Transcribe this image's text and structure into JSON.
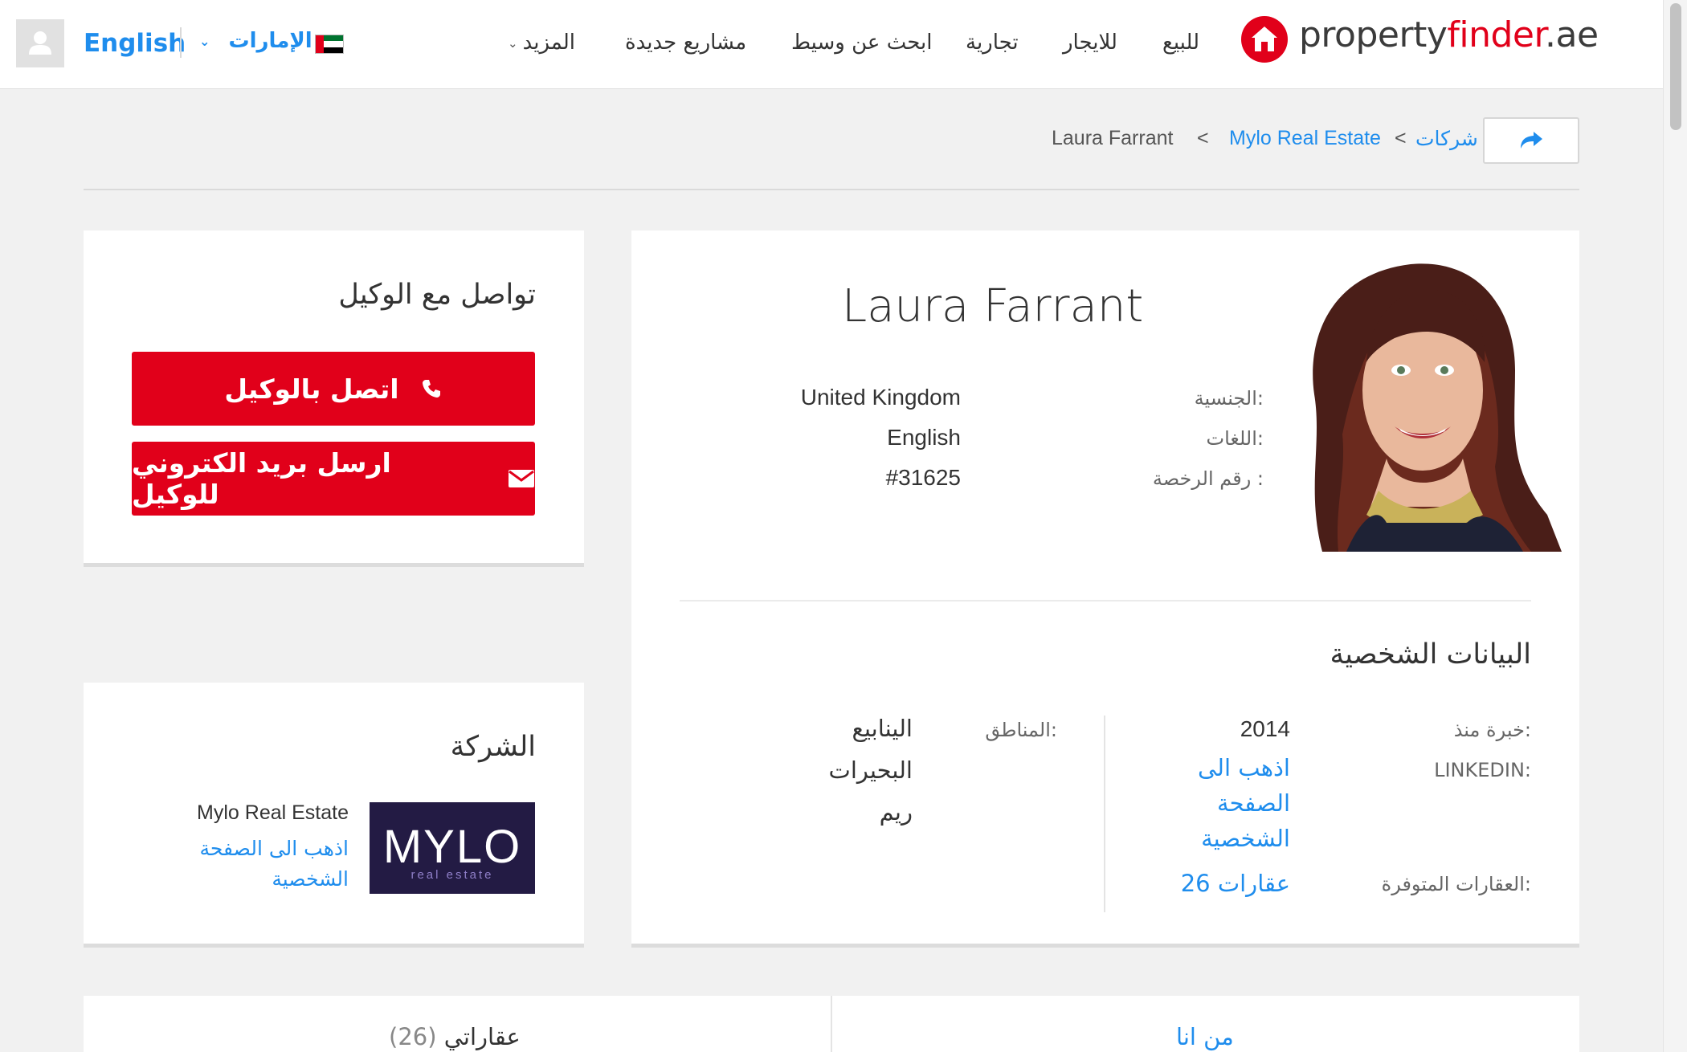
{
  "header": {
    "language_switch": "English",
    "country": "الإمارات",
    "nav": {
      "more": "المزيد",
      "new_projects": "مشاريع جديدة",
      "find_agent": "ابحث عن وسيط",
      "commercial": "تجارية",
      "rent": "للايجار",
      "buy": "للبيع"
    },
    "logo": {
      "part1": "property",
      "part2": "finder",
      "part3": ".ae"
    },
    "colors": {
      "brand_red": "#e1001a",
      "link_blue": "#1f8ded"
    }
  },
  "breadcrumb": {
    "companies": "شركات",
    "separator": "<",
    "company": "Mylo Real Estate",
    "agent": "Laura Farrant"
  },
  "contact": {
    "title": "تواصل مع الوكيل",
    "call_label": "اتصل بالوكيل",
    "email_label": "ارسل بريد الكتروني للوكيل"
  },
  "profile": {
    "name": "Laura Farrant",
    "nationality_label": "الجنسية:",
    "nationality": "United Kingdom",
    "languages_label": "اللغات:",
    "languages": "English",
    "license_label": "رقم الرخصة :",
    "license": "#31625"
  },
  "personal": {
    "title": "البيانات الشخصية",
    "experience_label": "خبرة منذ:",
    "experience": "2014",
    "linkedin_label": "LINKEDIN:",
    "linkedin_link_lines": [
      "اذهب الى",
      "الصفحة",
      "الشخصية"
    ],
    "properties_label": "العقارات المتوفرة:",
    "properties_link": "26 عقارات",
    "areas_label": "المناطق:",
    "areas": [
      "الينابيع",
      "البحيرات",
      "ريم"
    ]
  },
  "company": {
    "title": "الشركة",
    "name": "Mylo Real Estate",
    "link_lines": [
      "اذهب الى الصفحة",
      "الشخصية"
    ],
    "logo_text": "MYLO",
    "logo_sub": "real estate"
  },
  "bottom_tabs": {
    "about": "من انا",
    "my_properties": "عقاراتي",
    "count": "(26)"
  }
}
